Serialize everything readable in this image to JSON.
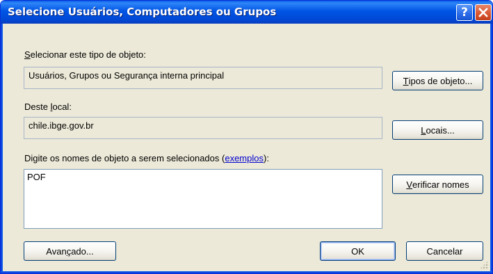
{
  "window": {
    "title": "Selecione Usuários, Computadores ou Grupos",
    "help_glyph": "?",
    "close_glyph": "✕"
  },
  "object_type": {
    "label_mnemonic": "S",
    "label_rest": "elecionar este tipo de objeto:",
    "value": "Usuários, Grupos ou Segurança interna principal",
    "button_mnemonic": "T",
    "button_rest": "ipos de objeto..."
  },
  "location": {
    "label_pre": "Deste ",
    "label_mnemonic": "l",
    "label_rest": "ocal:",
    "value": "chile.ibge.gov.br",
    "button_mnemonic": "L",
    "button_rest": "ocais..."
  },
  "names": {
    "label_pre": "Di",
    "label_mnemonic": "g",
    "label_mid": "ite os nomes de objeto a serem selecionados (",
    "label_link": "exemplos",
    "label_post": "):",
    "value": "POF",
    "check_mnemonic": "V",
    "check_rest": "erificar nomes"
  },
  "footer": {
    "advanced_pre": "Avan",
    "advanced_mnemonic": "ç",
    "advanced_rest": "ado...",
    "ok_label": "OK",
    "cancel_label": "Cancelar"
  },
  "colors": {
    "title_bar": "#0055e5",
    "dialog_bg": "#ece9d8",
    "link": "#0000cc",
    "close_button": "#d8542e"
  }
}
